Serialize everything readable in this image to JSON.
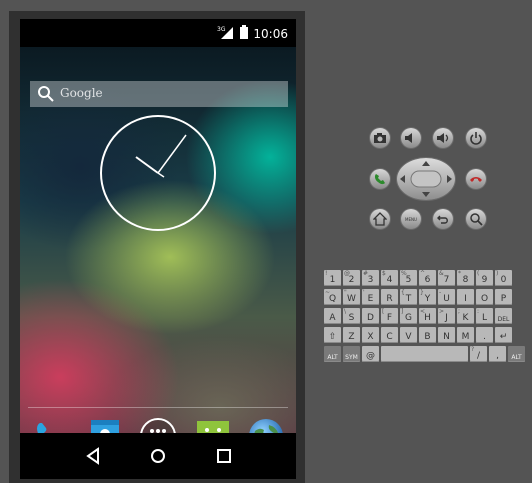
{
  "status_bar": {
    "network": "3G",
    "time": "10:06"
  },
  "search_bar": {
    "placeholder": "Google"
  },
  "dock": [
    {
      "name": "phone",
      "icon": "phone-icon"
    },
    {
      "name": "contacts",
      "icon": "contacts-icon"
    },
    {
      "name": "all-apps",
      "icon": "apps-grid-icon"
    },
    {
      "name": "messaging",
      "icon": "messaging-icon"
    },
    {
      "name": "browser",
      "icon": "globe-icon"
    }
  ],
  "nav": [
    "back",
    "home",
    "recents"
  ],
  "controls": [
    {
      "name": "camera",
      "icon": "camera-icon"
    },
    {
      "name": "volume-down",
      "icon": "volume-down-icon"
    },
    {
      "name": "volume-up",
      "icon": "volume-up-icon"
    },
    {
      "name": "power",
      "icon": "power-icon"
    },
    {
      "name": "call",
      "icon": "call-icon"
    },
    {
      "name": "end-call",
      "icon": "end-call-icon"
    },
    {
      "name": "home",
      "icon": "home-icon"
    },
    {
      "name": "menu",
      "icon": "menu-icon",
      "label": "MENU"
    },
    {
      "name": "back",
      "icon": "back-icon"
    },
    {
      "name": "search",
      "icon": "search-icon"
    }
  ],
  "keyboard": {
    "row1": [
      {
        "main": "1",
        "alt": "!"
      },
      {
        "main": "2",
        "alt": "@"
      },
      {
        "main": "3",
        "alt": "#"
      },
      {
        "main": "4",
        "alt": "$"
      },
      {
        "main": "5",
        "alt": "%"
      },
      {
        "main": "6",
        "alt": "^"
      },
      {
        "main": "7",
        "alt": "&"
      },
      {
        "main": "8",
        "alt": "*"
      },
      {
        "main": "9",
        "alt": "("
      },
      {
        "main": "0",
        "alt": ")"
      }
    ],
    "row2": [
      {
        "main": "Q",
        "alt": "~"
      },
      {
        "main": "W",
        "alt": "\""
      },
      {
        "main": "E",
        "alt": "'"
      },
      {
        "main": "R",
        "alt": ""
      },
      {
        "main": "T",
        "alt": "{"
      },
      {
        "main": "Y",
        "alt": "}"
      },
      {
        "main": "U",
        "alt": "-"
      },
      {
        "main": "I",
        "alt": ""
      },
      {
        "main": "O",
        "alt": ""
      },
      {
        "main": "P",
        "alt": ""
      }
    ],
    "row3": [
      {
        "main": "A",
        "alt": ""
      },
      {
        "main": "S",
        "alt": "\\"
      },
      {
        "main": "D",
        "alt": ""
      },
      {
        "main": "F",
        "alt": "["
      },
      {
        "main": "G",
        "alt": "]"
      },
      {
        "main": "H",
        "alt": "<"
      },
      {
        "main": "J",
        "alt": ">"
      },
      {
        "main": "K",
        "alt": ";"
      },
      {
        "main": "L",
        "alt": ":"
      },
      {
        "main": "DEL",
        "alt": ""
      }
    ],
    "row4": [
      {
        "main": "⇧",
        "alt": ""
      },
      {
        "main": "Z",
        "alt": ""
      },
      {
        "main": "X",
        "alt": ""
      },
      {
        "main": "C",
        "alt": ""
      },
      {
        "main": "V",
        "alt": ""
      },
      {
        "main": "B",
        "alt": ""
      },
      {
        "main": "N",
        "alt": ""
      },
      {
        "main": "M",
        "alt": ""
      },
      {
        "main": ".",
        "alt": ""
      },
      {
        "main": "↵",
        "alt": ""
      }
    ],
    "row5": [
      {
        "main": "ALT",
        "alt": ""
      },
      {
        "main": "SYM",
        "alt": ""
      },
      {
        "main": "@",
        "alt": ""
      },
      {
        "main": "",
        "alt": ""
      },
      {
        "main": "/",
        "alt": "?"
      },
      {
        "main": ",",
        "alt": ""
      },
      {
        "main": "ALT",
        "alt": ""
      }
    ]
  }
}
